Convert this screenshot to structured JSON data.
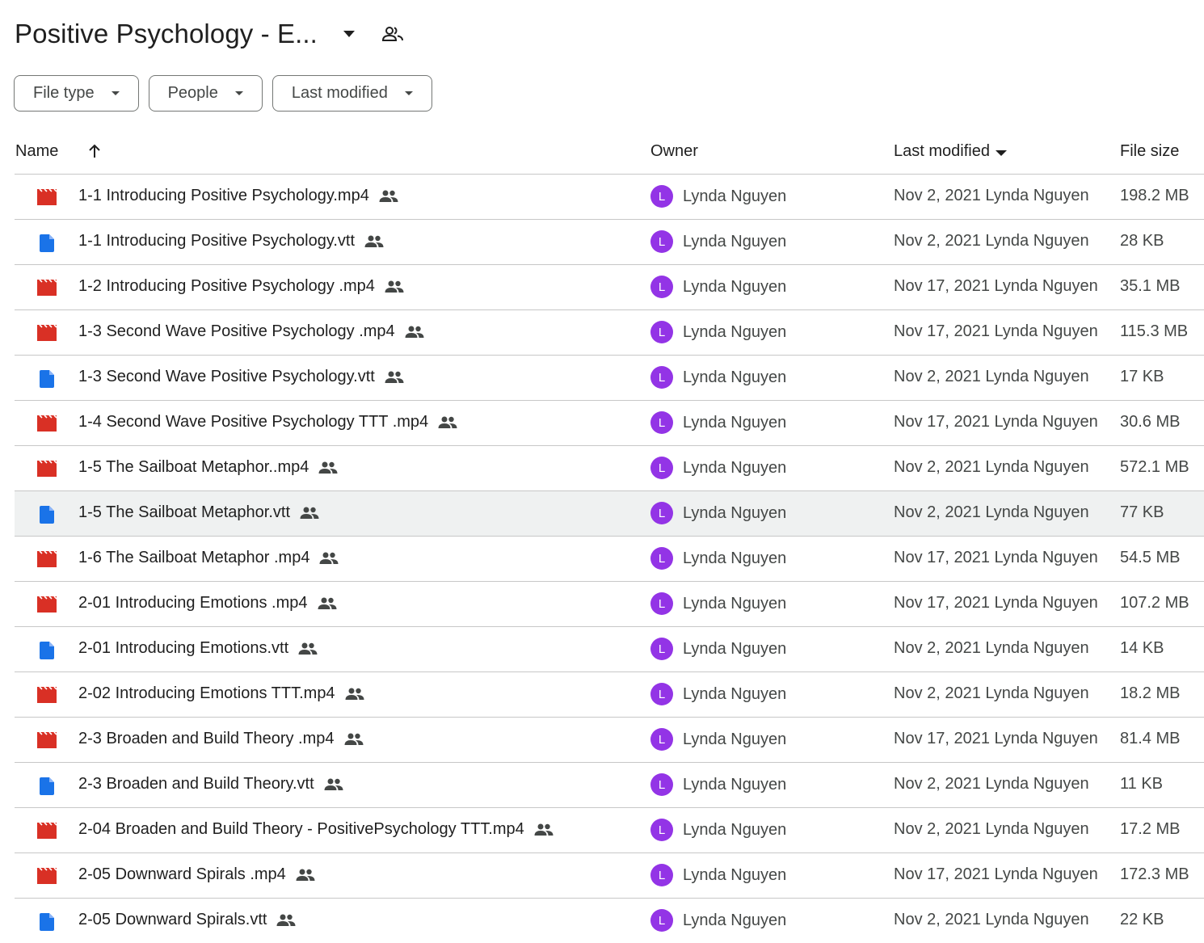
{
  "folder": {
    "title": "Positive Psychology - E...",
    "caret_icon": "arrow-drop-down-icon",
    "shared_icon": "people-icon"
  },
  "filters": [
    {
      "label": "File type"
    },
    {
      "label": "People"
    },
    {
      "label": "Last modified"
    }
  ],
  "columns": {
    "name": "Name",
    "owner": "Owner",
    "last_modified": "Last modified",
    "file_size": "File size"
  },
  "colors": {
    "video_icon": "#d93025",
    "doc_icon": "#1a73e8",
    "avatar": "#9334e6",
    "selected_row": "#eff1f1"
  },
  "files": [
    {
      "name": "1-1 Introducing Positive Psychology.mp4",
      "type": "video",
      "owner_initial": "L",
      "owner": "Lynda Nguyen",
      "modified": "Nov 2, 2021 Lynda Nguyen",
      "size": "198.2 MB"
    },
    {
      "name": "1-1 Introducing Positive Psychology.vtt",
      "type": "doc",
      "owner_initial": "L",
      "owner": "Lynda Nguyen",
      "modified": "Nov 2, 2021 Lynda Nguyen",
      "size": "28 KB"
    },
    {
      "name": "1-2 Introducing Positive Psychology .mp4",
      "type": "video",
      "owner_initial": "L",
      "owner": "Lynda Nguyen",
      "modified": "Nov 17, 2021 Lynda Nguyen",
      "size": "35.1 MB"
    },
    {
      "name": "1-3 Second Wave Positive Psychology .mp4",
      "type": "video",
      "owner_initial": "L",
      "owner": "Lynda Nguyen",
      "modified": "Nov 17, 2021 Lynda Nguyen",
      "size": "115.3 MB"
    },
    {
      "name": "1-3 Second Wave Positive Psychology.vtt",
      "type": "doc",
      "owner_initial": "L",
      "owner": "Lynda Nguyen",
      "modified": "Nov 2, 2021 Lynda Nguyen",
      "size": "17 KB"
    },
    {
      "name": "1-4 Second Wave Positive Psychology TTT .mp4",
      "type": "video",
      "owner_initial": "L",
      "owner": "Lynda Nguyen",
      "modified": "Nov 17, 2021 Lynda Nguyen",
      "size": "30.6 MB"
    },
    {
      "name": "1-5 The Sailboat Metaphor..mp4",
      "type": "video",
      "owner_initial": "L",
      "owner": "Lynda Nguyen",
      "modified": "Nov 2, 2021 Lynda Nguyen",
      "size": "572.1 MB"
    },
    {
      "name": "1-5 The Sailboat Metaphor.vtt",
      "type": "doc",
      "owner_initial": "L",
      "owner": "Lynda Nguyen",
      "modified": "Nov 2, 2021 Lynda Nguyen",
      "size": "77 KB",
      "selected": true
    },
    {
      "name": "1-6 The Sailboat Metaphor .mp4",
      "type": "video",
      "owner_initial": "L",
      "owner": "Lynda Nguyen",
      "modified": "Nov 17, 2021 Lynda Nguyen",
      "size": "54.5 MB"
    },
    {
      "name": "2-01 Introducing Emotions .mp4",
      "type": "video",
      "owner_initial": "L",
      "owner": "Lynda Nguyen",
      "modified": "Nov 17, 2021 Lynda Nguyen",
      "size": "107.2 MB"
    },
    {
      "name": "2-01 Introducing Emotions.vtt",
      "type": "doc",
      "owner_initial": "L",
      "owner": "Lynda Nguyen",
      "modified": "Nov 2, 2021 Lynda Nguyen",
      "size": "14 KB"
    },
    {
      "name": "2-02 Introducing Emotions TTT.mp4",
      "type": "video",
      "owner_initial": "L",
      "owner": "Lynda Nguyen",
      "modified": "Nov 2, 2021 Lynda Nguyen",
      "size": "18.2 MB"
    },
    {
      "name": "2-3 Broaden and Build Theory .mp4",
      "type": "video",
      "owner_initial": "L",
      "owner": "Lynda Nguyen",
      "modified": "Nov 17, 2021 Lynda Nguyen",
      "size": "81.4 MB"
    },
    {
      "name": "2-3 Broaden and Build Theory.vtt",
      "type": "doc",
      "owner_initial": "L",
      "owner": "Lynda Nguyen",
      "modified": "Nov 2, 2021 Lynda Nguyen",
      "size": "11 KB"
    },
    {
      "name": "2-04 Broaden and Build Theory - PositivePsychology TTT.mp4",
      "type": "video",
      "owner_initial": "L",
      "owner": "Lynda Nguyen",
      "modified": "Nov 2, 2021 Lynda Nguyen",
      "size": "17.2 MB"
    },
    {
      "name": "2-05 Downward Spirals .mp4",
      "type": "video",
      "owner_initial": "L",
      "owner": "Lynda Nguyen",
      "modified": "Nov 17, 2021 Lynda Nguyen",
      "size": "172.3 MB"
    },
    {
      "name": "2-05 Downward Spirals.vtt",
      "type": "doc",
      "owner_initial": "L",
      "owner": "Lynda Nguyen",
      "modified": "Nov 2, 2021 Lynda Nguyen",
      "size": "22 KB"
    }
  ]
}
